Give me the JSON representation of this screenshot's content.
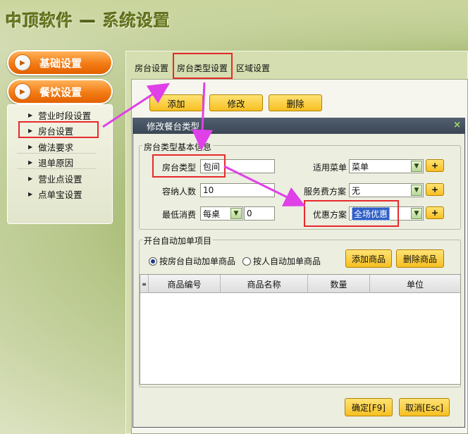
{
  "app": {
    "title": "中顶软件",
    "dash": "—",
    "subtitle": "系统设置"
  },
  "nav": {
    "basic": "基础设置",
    "dining": "餐饮设置",
    "items": [
      "营业时段设置",
      "房台设置",
      "做法要求",
      "退单原因",
      "营业点设置",
      "点单宝设置"
    ]
  },
  "tabs": [
    "房台设置",
    "房台类型设置",
    "区域设置"
  ],
  "toolbar": {
    "add": "添加",
    "edit": "修改",
    "delete": "删除"
  },
  "dialog": {
    "title": "修改餐台类型",
    "close": "×",
    "basic_group": "房台类型基本信息",
    "room_type_label": "房台类型",
    "room_type_value": "包间",
    "capacity_label": "容纳人数",
    "capacity_value": "10",
    "min_spend_label": "最低消费",
    "min_spend_mode": "每桌",
    "min_spend_value": "0",
    "menu_label": "适用菜单",
    "menu_value": "菜单",
    "service_label": "服务费方案",
    "service_value": "无",
    "discount_label": "优惠方案",
    "discount_value": "全场优惠",
    "plus": "+",
    "auto_group": "开台自动加单项目",
    "radio_room": "按房台自动加单商品",
    "radio_person": "按人自动加单商品",
    "add_item": "添加商品",
    "delete_item": "删除商品",
    "columns": [
      "商品编号",
      "商品名称",
      "数量",
      "单位"
    ],
    "ok": "确定[F9]",
    "cancel": "取消[Esc]"
  },
  "colors": {
    "accent": "#f27b14",
    "highlight": "#e8292d",
    "arrow": "#e040e8"
  }
}
